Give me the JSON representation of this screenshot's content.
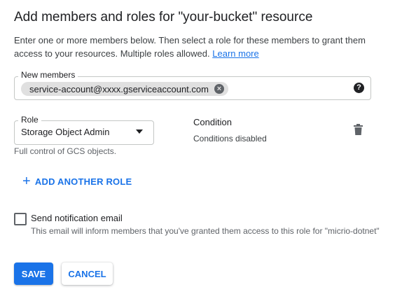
{
  "dialog": {
    "title": "Add members and roles for \"your-bucket\" resource",
    "description": "Enter one or more members below. Then select a role for these members to grant them access to your resources. Multiple roles allowed.",
    "learn_more": "Learn more"
  },
  "members": {
    "label": "New members",
    "chips": [
      {
        "text": "service-account@xxxx.gserviceaccount.com",
        "remove_icon": "cancel-circle-icon"
      }
    ],
    "help_icon": "help-icon"
  },
  "role": {
    "label": "Role",
    "selected": "Storage Object Admin",
    "help_text": "Full control of GCS objects."
  },
  "condition": {
    "title": "Condition",
    "value": "Conditions disabled"
  },
  "add_role": {
    "icon": "+",
    "label": "ADD ANOTHER ROLE"
  },
  "notification": {
    "checked": false,
    "label": "Send notification email",
    "help_text": "This email will inform members that you've granted them access to this role for \"micrio-dotnet\""
  },
  "actions": {
    "save": "SAVE",
    "cancel": "CANCEL"
  },
  "colors": {
    "accent": "#1a73e8",
    "chip_bg": "#e0e0e0",
    "border": "#c4c7c5"
  }
}
